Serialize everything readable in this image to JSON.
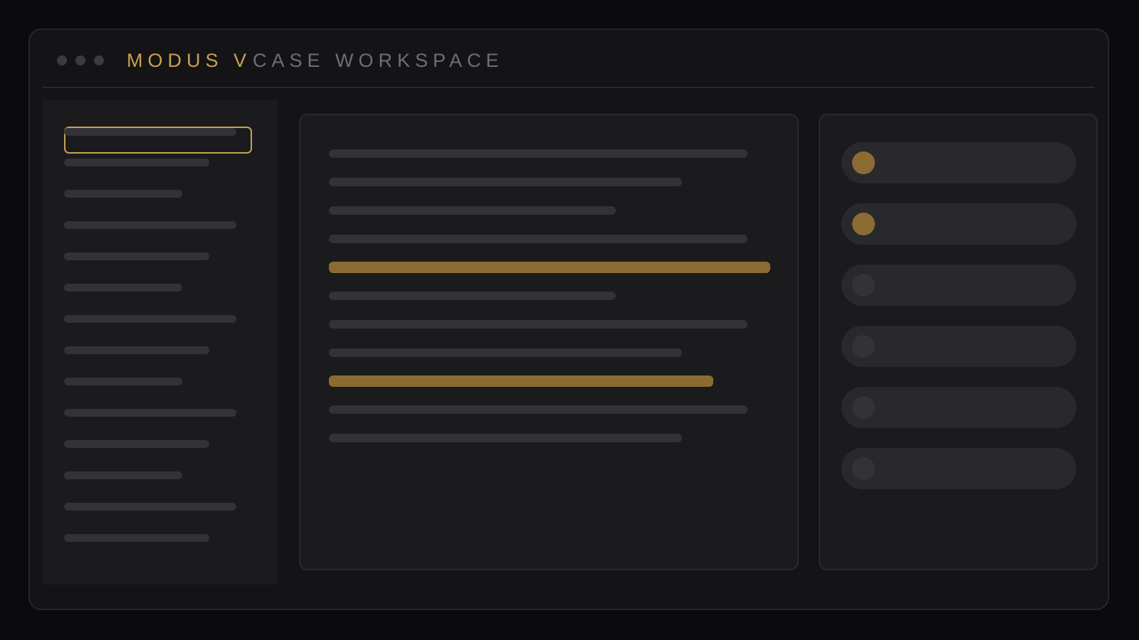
{
  "header": {
    "brand": "MODUS V",
    "section_title": "CASE WORKSPACE",
    "window_controls": [
      "window-dot",
      "window-dot",
      "window-dot"
    ]
  },
  "sidebar": {
    "selected_index": 0,
    "item_count": 14
  },
  "document": {
    "line_count": 11,
    "highlighted_lines": [
      4,
      8
    ]
  },
  "checklist": {
    "items": [
      {
        "checked": true
      },
      {
        "checked": true
      },
      {
        "checked": false
      },
      {
        "checked": false
      },
      {
        "checked": false
      },
      {
        "checked": false
      }
    ]
  },
  "colors": {
    "accent": "#c9a24e",
    "accent_muted": "#8a6c33",
    "background": "#0b0b0d",
    "panel": "#1b1b1e",
    "placeholder": "#333337"
  }
}
